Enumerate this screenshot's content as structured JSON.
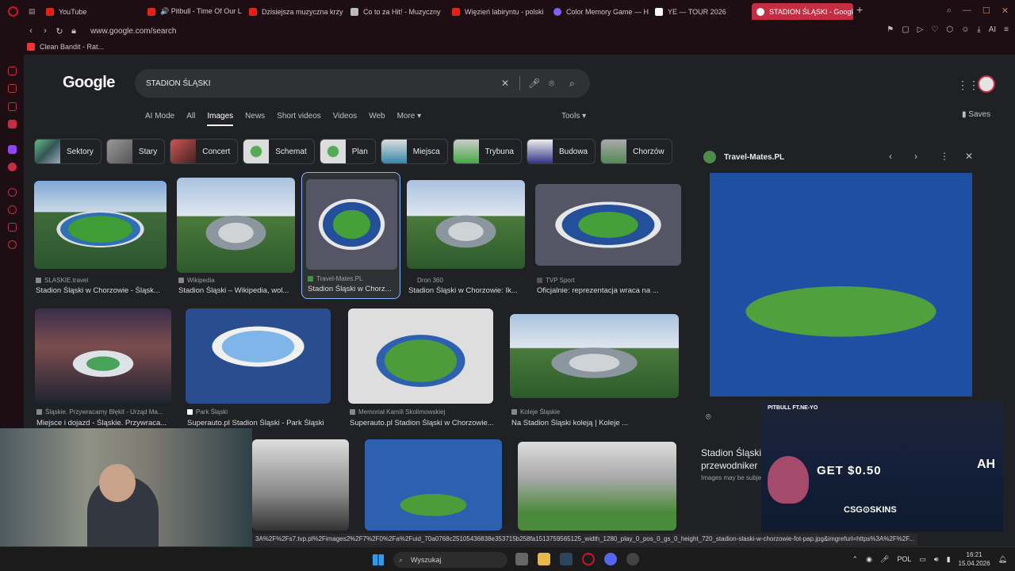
{
  "browser": {
    "tabs": [
      {
        "label": "YouTube",
        "color": "#e62117"
      },
      {
        "label": "🔊 Pitbull - Time Of Our L",
        "color": "#e62117"
      },
      {
        "label": "Dzisiejsza muzyczna krzy",
        "color": "#e62117"
      },
      {
        "label": "Co to za Hit! - Muzyczny",
        "color": "#bbbbbb"
      },
      {
        "label": "Więzień labiryntu - polski",
        "color": "#e62117"
      },
      {
        "label": "Color Memory Game — H",
        "color": "#7b61ff"
      },
      {
        "label": "YE — TOUR 2026",
        "color": "#ffffff"
      },
      {
        "label": "STADION ŚLĄSKI - Google",
        "color": "#4285f4"
      }
    ],
    "url": "www.google.com/search",
    "bookmark": "Clean Bandit - Rat..."
  },
  "google": {
    "logo": "Google",
    "query": "STADION ŚLĄSKI",
    "nav": [
      "AI Mode",
      "All",
      "Images",
      "News",
      "Short videos",
      "Videos",
      "Web",
      "More ▾"
    ],
    "tools": "Tools ▾",
    "saves": "Saves",
    "chips": [
      "Sektory",
      "Stary",
      "Concert",
      "Schemat",
      "Plan",
      "Miejsca",
      "Trybuna",
      "Budowa",
      "Chorzów"
    ]
  },
  "results": [
    {
      "source": "SLASKIE.travel",
      "title": "Stadion Śląski w Chorzowie - Śląsk..."
    },
    {
      "source": "Wikipedia",
      "title": "Stadion Śląski – Wikipedia, wol..."
    },
    {
      "source": "Travel-Mates.PL",
      "title": "Stadion Śląski w Chorz..."
    },
    {
      "source": "Dron 360",
      "title": "Stadion Śląski w Chorzowie: Ik..."
    },
    {
      "source": "TVP Sport",
      "title": "Oficjalnie: reprezentacja wraca na ..."
    },
    {
      "source": "Śląskie. Przywracamy Błękit - Urząd Ma...",
      "title": "Miejsce i dojazd - Śląskie. Przywraca..."
    },
    {
      "source": "Park Śląski",
      "title": "Superauto.pl Stadion Śląski - Park Śląski"
    },
    {
      "source": "Memoriał Kamili Skolimowskiej",
      "title": "Superauto.pl Stadion Śląski w Chorzowie..."
    },
    {
      "source": "Koleje Śląskie",
      "title": "Na Stadion Śląski koleją | Koleje ..."
    }
  ],
  "panel": {
    "source": "Travel-Mates.PL",
    "title": "Stadion Śląski przewodniker",
    "note": "Images may be subje"
  },
  "ad": {
    "top": "PITBULL FT.NE-YO",
    "offer": "GET $0.50",
    "brand": "CSG⊙SKINS",
    "corner": "AH"
  },
  "status_url": "3A%2F%2Fs7.tvp.pl%2Fimages2%2F7%2F0%2Fa%2Fuid_70a0768c25105436838e353715b258fa1513759565125_width_1280_play_0_pos_0_gs_0_height_720_stadion-slaski-w-chorzowie-fot-pap.jpg&imgrefurl=https%3A%2F%2F...",
  "taskbar": {
    "search": "Wyszukaj",
    "lang": "POL",
    "time": "16:21",
    "date": "15.04.2026"
  }
}
